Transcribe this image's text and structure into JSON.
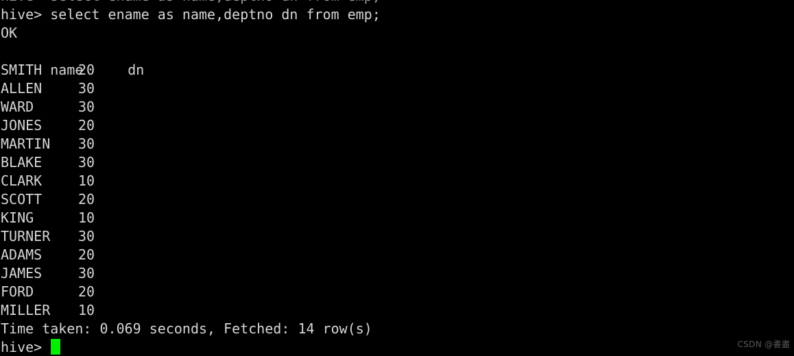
{
  "terminal": {
    "background_color": "#000000",
    "text_color": "#d6d6d6",
    "cursor_color": "#00f000",
    "clipped_top_line": "hive> select ename as name,deptno dn from emp;",
    "command_line": "hive> select ename as name,deptno dn from emp;",
    "status_ok": "OK",
    "header": {
      "name": "name",
      "dn": "dn"
    },
    "rows": [
      {
        "name": "SMITH",
        "dn": "20"
      },
      {
        "name": "ALLEN",
        "dn": "30"
      },
      {
        "name": "WARD",
        "dn": "30"
      },
      {
        "name": "JONES",
        "dn": "20"
      },
      {
        "name": "MARTIN",
        "dn": "30"
      },
      {
        "name": "BLAKE",
        "dn": "30"
      },
      {
        "name": "CLARK",
        "dn": "10"
      },
      {
        "name": "SCOTT",
        "dn": "20"
      },
      {
        "name": "KING",
        "dn": "10"
      },
      {
        "name": "TURNER",
        "dn": "30"
      },
      {
        "name": "ADAMS",
        "dn": "20"
      },
      {
        "name": "JAMES",
        "dn": "30"
      },
      {
        "name": "FORD",
        "dn": "20"
      },
      {
        "name": "MILLER",
        "dn": "10"
      }
    ],
    "summary_line": "Time taken: 0.069 seconds, Fetched: 14 row(s)",
    "prompt": "hive> "
  },
  "watermark": {
    "text": "CSDN @書盡"
  }
}
